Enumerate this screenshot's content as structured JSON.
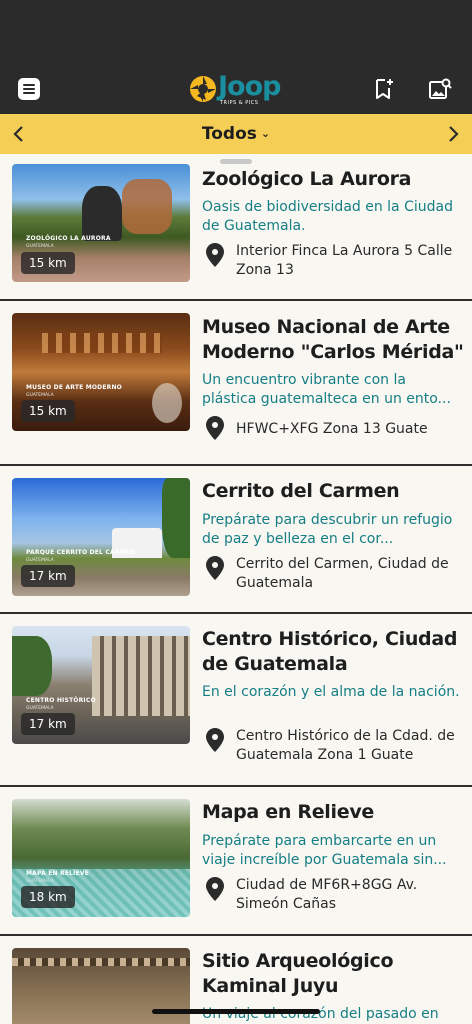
{
  "app": {
    "logo_text": "Joop",
    "logo_sub": "TRIPS & PICS"
  },
  "header": {
    "menu_icon": "menu-icon",
    "bookmark_icon": "bookmark-add-icon",
    "gallery_icon": "image-search-icon"
  },
  "filter": {
    "label": "Todos",
    "prev_icon": "chevron-left-icon",
    "next_icon": "chevron-right-icon"
  },
  "places": [
    {
      "title": "Zoológico La Aurora",
      "description": "Oasis de biodiversidad en la Ciudad de Guatemala.",
      "address": "Interior Finca La Aurora 5 Calle Zona 13",
      "distance": "15 km",
      "image_label": "ZOOLÓGICO LA AURORA",
      "image_sublabel": "GUATEMALA"
    },
    {
      "title": "Museo Nacional de Arte Moderno \"Carlos Mérida\"",
      "description": "Un encuentro vibrante con la plástica guatemalteca en un ento...",
      "address": "HFWC+XFG Zona 13 Guate",
      "distance": "15 km",
      "image_label": "MUSEO DE ARTE MODERNO",
      "image_sublabel": "GUATEMALA"
    },
    {
      "title": "Cerrito del Carmen",
      "description": "Prepárate para descubrir un refugio de paz y belleza en el cor...",
      "address": "Cerrito del Carmen, Ciudad de Guatemala",
      "distance": "17 km",
      "image_label": "PARQUE CERRITO DEL CARMEN",
      "image_sublabel": "GUATEMALA"
    },
    {
      "title": "Centro Histórico, Ciudad de Guatemala",
      "description": "En el corazón y el alma de la nación.",
      "address": "Centro Histórico de la Cdad. de Guatemala Zona 1 Guate",
      "distance": "17 km",
      "image_label": "CENTRO HISTÓRICO",
      "image_sublabel": "GUATEMALA"
    },
    {
      "title": "Mapa en Relieve",
      "description": "Prepárate para embarcarte en un viaje increíble por Guatemala sin...",
      "address": "Ciudad de MF6R+8GG Av. Simeón Cañas",
      "distance": "18 km",
      "image_label": "MAPA EN RELIEVE",
      "image_sublabel": "GUATEMALA"
    },
    {
      "title": "Sitio Arqueológico Kaminal Juyu",
      "description": "Un viaje al corazón del pasado en",
      "address": "",
      "distance": "",
      "image_label": "",
      "image_sublabel": ""
    }
  ],
  "colors": {
    "header_bg": "#2b2b2b",
    "filter_bg": "#f5cf55",
    "accent": "#167e85",
    "logo_blue": "#1a8fa0",
    "logo_yellow": "#f5b820"
  }
}
